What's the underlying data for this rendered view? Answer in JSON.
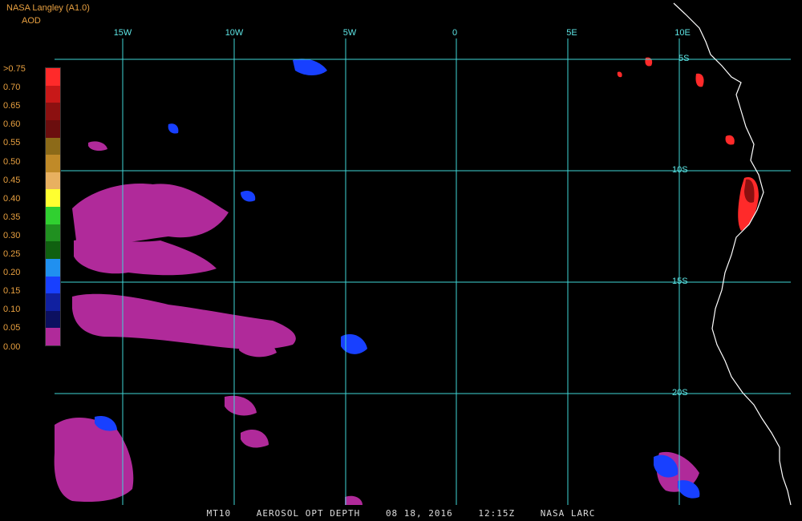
{
  "header": {
    "product": "NASA Langley (A1.0)",
    "units": "AOD"
  },
  "map": {
    "lon_labels": [
      "15W",
      "10W",
      "5W",
      "0",
      "5E",
      "10E"
    ],
    "lat_labels": [
      "5S",
      "10S",
      "15S",
      "20S"
    ],
    "colors": {
      "grid": "#3fd6d6",
      "coastline": "#ffffff",
      "background": "#000000"
    }
  },
  "legend": {
    "labels": [
      ">0.75",
      "0.70",
      "0.65",
      "0.60",
      "0.55",
      "0.50",
      "0.45",
      "0.40",
      "0.35",
      "0.30",
      "0.25",
      "0.20",
      "0.15",
      "0.10",
      "0.05",
      "0.00"
    ],
    "colors": [
      "#ff2a2a",
      "#c81818",
      "#8c1010",
      "#6b0e0e",
      "#8c6a18",
      "#c08a28",
      "#e8b060",
      "#ffff30",
      "#30d030",
      "#209020",
      "#106010",
      "#2090f0",
      "#1840ff",
      "#1020a0",
      "#0c1060",
      "#b02a9a"
    ]
  },
  "footer": {
    "sensor": "MT10",
    "product_name": "AEROSOL OPT DEPTH",
    "date": "08 18, 2016",
    "time": "12:15Z",
    "agency": "NASA LARC"
  }
}
